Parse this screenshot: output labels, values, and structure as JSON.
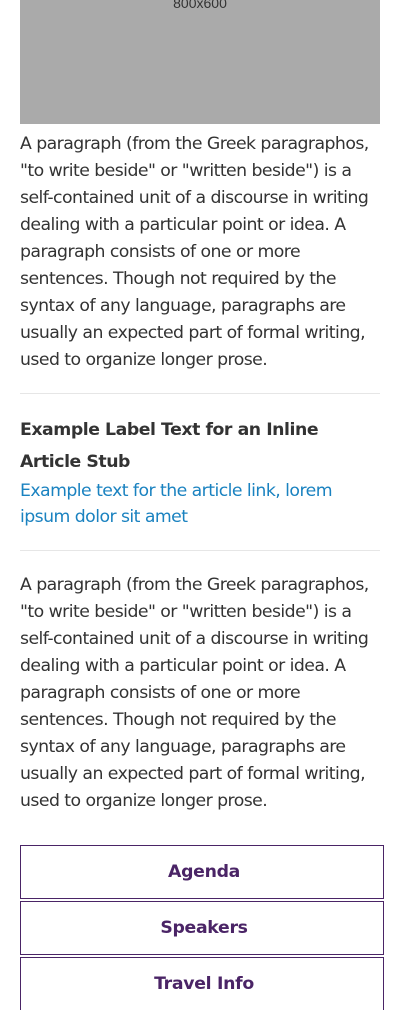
{
  "hero": {
    "caption": "800x600"
  },
  "paragraphs": [
    "A paragraph (from the Greek paragraphos, \"to write beside\" or \"written beside\") is a self-contained unit of a discourse in writing dealing with a particular point or idea. A paragraph consists of one or more sentences. Though not required by the syntax of any language, paragraphs are usually an expected part of formal writing, used to organize longer prose.",
    "A paragraph (from the Greek paragraphos, \"to write beside\" or \"written beside\") is a self-contained unit of a discourse in writing dealing with a particular point or idea. A paragraph consists of one or more sentences. Though not required by the syntax of any language, paragraphs are usually an expected part of formal writing, used to organize longer prose."
  ],
  "article_stub": {
    "label": "Example Label Text for an Inline Article Stub",
    "link_text": "Example text for the article link, lorem ipsum dolor sit amet"
  },
  "nav_buttons": [
    {
      "label": "Agenda"
    },
    {
      "label": "Speakers"
    },
    {
      "label": "Travel Info"
    }
  ],
  "colors": {
    "placeholder": "#aaaaaa",
    "text": "#333333",
    "link": "#1a82c0",
    "button_accent": "#4a2466",
    "divider": "#e6e6e6"
  }
}
